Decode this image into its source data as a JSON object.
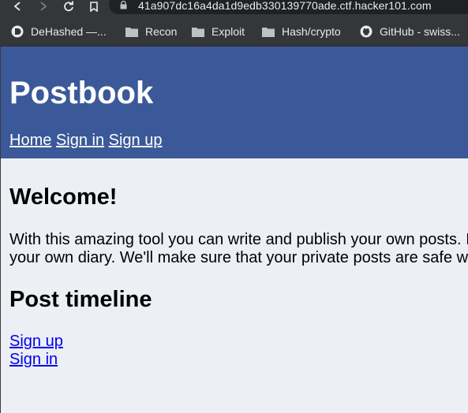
{
  "browser": {
    "url": "41a907dc16a4da1d9edb330139770ade.ctf.hacker101.com",
    "bookmarks": [
      {
        "label": "DeHashed —...",
        "icon": "dehashed-icon"
      },
      {
        "label": "Recon",
        "icon": "folder-icon"
      },
      {
        "label": "Exploit",
        "icon": "folder-icon"
      },
      {
        "label": "Hash/crypto",
        "icon": "folder-icon"
      },
      {
        "label": "GitHub - swiss...",
        "icon": "github-icon"
      }
    ]
  },
  "site": {
    "title": "Postbook",
    "nav": {
      "home": "Home",
      "sign_in": "Sign in",
      "sign_up": "Sign up"
    }
  },
  "main": {
    "welcome_heading": "Welcome!",
    "intro_line1": "With this amazing tool you can write and publish your own posts. I",
    "intro_line2": "your own diary. We'll make sure that your private posts are safe w",
    "timeline_heading": "Post timeline",
    "timeline_links": {
      "sign_up": "Sign up",
      "sign_in": "Sign in"
    }
  },
  "colors": {
    "header_bg": "#3b5998",
    "page_bg": "#eceff4",
    "link": "#0000ee"
  }
}
